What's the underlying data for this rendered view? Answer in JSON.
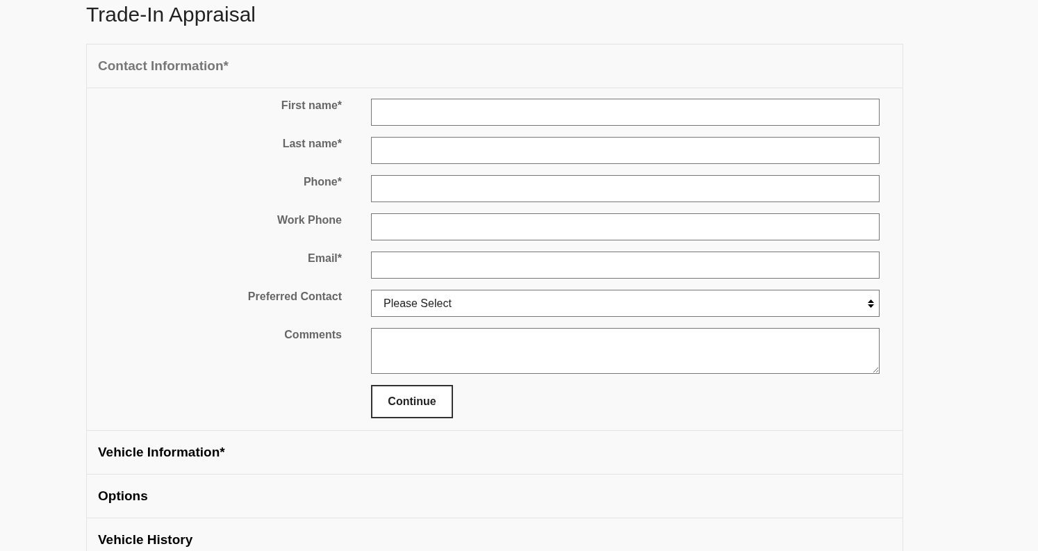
{
  "page_title": "Trade-In Appraisal",
  "sections": [
    {
      "title": "Contact Information*",
      "expanded": true,
      "fields": [
        {
          "kind": "text",
          "label": "First name*"
        },
        {
          "kind": "text",
          "label": "Last name*"
        },
        {
          "kind": "text",
          "label": "Phone*"
        },
        {
          "kind": "text",
          "label": "Work Phone"
        },
        {
          "kind": "text",
          "label": "Email*"
        },
        {
          "kind": "select",
          "label": "Preferred Contact",
          "value": "Please Select"
        },
        {
          "kind": "textarea",
          "label": "Comments"
        }
      ],
      "button": "Continue"
    },
    {
      "title": "Vehicle Information*",
      "expanded": false
    },
    {
      "title": "Options",
      "expanded": false
    },
    {
      "title": "Vehicle History",
      "expanded": false
    }
  ]
}
